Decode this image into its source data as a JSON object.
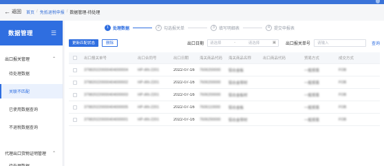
{
  "breadcrumb": {
    "back": "返回",
    "items": [
      "首页",
      "免抵退税申报",
      "数据管理-待处理"
    ]
  },
  "sidebar": {
    "title": "数据管理",
    "groups": [
      {
        "label": "出口报关管理",
        "items": [
          "待处理数据",
          "关联不匹配",
          "已使用数据查询",
          "不退税数据查询"
        ]
      },
      {
        "label": "代理出口货物证明管理",
        "items": [
          "待处理数据"
        ]
      }
    ]
  },
  "steps": [
    {
      "num": "1",
      "label": "处理数据"
    },
    {
      "num": "2",
      "label": "勾选报关单"
    },
    {
      "num": "3",
      "label": "填写明细表"
    },
    {
      "num": "4",
      "label": "提交申报表"
    }
  ],
  "toolbar": {
    "update_btn": "更新匹配状态",
    "delete_btn": "删除",
    "date_label": "出口日期",
    "date_start_ph": "请选择",
    "date_sep": "-",
    "date_end_ph": "请选择",
    "decl_label": "出口报关单号",
    "decl_ph": "请输入",
    "query": "查询"
  },
  "table": {
    "headers": [
      "出口报关单号",
      "出口合同号",
      "出口日期",
      "海关商品代码",
      "海关商品名称",
      "出口商品代码",
      "贸易方式",
      "成交方式"
    ],
    "rows": [
      {
        "decl": "379820220000404000004",
        "contract": "HP-AN-2201",
        "date": "2022-07-16",
        "hs": "7606200000",
        "name": "铝合金板",
        "gcode": "",
        "trade": "一般贸易",
        "deal": "FOB"
      },
      {
        "decl": "379820220000404000002",
        "contract": "HP-AN-2201",
        "date": "2022-07-16",
        "hs": "7606200000",
        "name": "铝合金带材",
        "gcode": "",
        "trade": "一般贸易",
        "deal": "FOB"
      },
      {
        "decl": "379820220000404000003",
        "contract": "HP-AN-2201",
        "date": "2022-07-16",
        "hs": "7606200000",
        "name": "铝合金板材",
        "gcode": "",
        "trade": "一般贸易",
        "deal": "FOB"
      },
      {
        "decl": "379820220000404000005",
        "contract": "HP-AN-2201",
        "date": "2022-07-16",
        "hs": "7606110000",
        "name": "铝合金板",
        "gcode": "",
        "trade": "一般贸易",
        "deal": "FOB"
      },
      {
        "decl": "379820220000404000001",
        "contract": "HP-AN-2201",
        "date": "2022-07-16",
        "hs": "7606290000",
        "name": "铝合金带材",
        "gcode": "",
        "trade": "一般贸易",
        "deal": "FOB"
      }
    ]
  },
  "colors": {
    "accent": "#2f6ee0",
    "sidebar_active_bg": "#eaf1fd"
  }
}
